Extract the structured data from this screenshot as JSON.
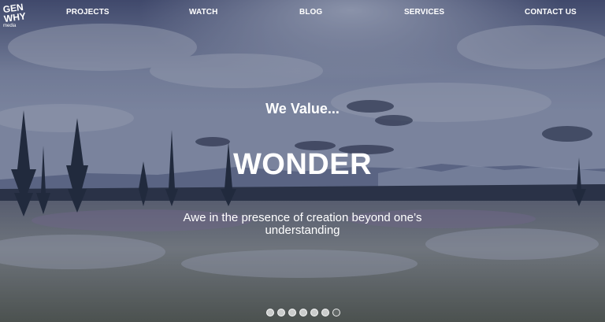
{
  "logo": {
    "line1": "GEN",
    "line2": "WHY",
    "line3": "media"
  },
  "nav": {
    "items": [
      "PROJECTS",
      "WATCH",
      "BLOG",
      "SERVICES",
      "CONTACT US"
    ]
  },
  "hero": {
    "eyebrow": "We Value...",
    "headline": "WONDER",
    "description": "Awe in the presence of creation beyond one’s understanding"
  },
  "carousel": {
    "slide_count": 7,
    "active_index": 6
  }
}
